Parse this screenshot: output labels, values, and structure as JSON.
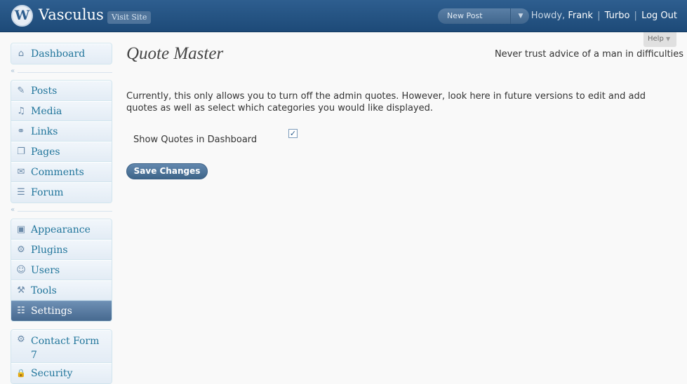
{
  "header": {
    "logo_letter": "W",
    "site_title": "Vasculus",
    "visit_site": "Visit Site",
    "new_post": "New Post",
    "new_post_arrow": "▼",
    "howdy": "Howdy,",
    "user_name": "Frank",
    "sep1": "|",
    "turbo": "Turbo",
    "sep2": "|",
    "log_out": "Log Out"
  },
  "help": {
    "label": "Help",
    "arrow": "▼"
  },
  "sidebar": {
    "group1": [
      {
        "label": "Dashboard",
        "icon": "dashboard-icon",
        "glyph": "⌂"
      }
    ],
    "group2": [
      {
        "label": "Posts",
        "icon": "posts-icon",
        "glyph": "✎"
      },
      {
        "label": "Media",
        "icon": "media-icon",
        "glyph": "♫"
      },
      {
        "label": "Links",
        "icon": "links-icon",
        "glyph": "⚭"
      },
      {
        "label": "Pages",
        "icon": "pages-icon",
        "glyph": "❐"
      },
      {
        "label": "Comments",
        "icon": "comments-icon",
        "glyph": "✉"
      },
      {
        "label": "Forum",
        "icon": "forum-icon",
        "glyph": "☰"
      }
    ],
    "group3": [
      {
        "label": "Appearance",
        "icon": "appearance-icon",
        "glyph": "▣"
      },
      {
        "label": "Plugins",
        "icon": "plugins-icon",
        "glyph": "⚙"
      },
      {
        "label": "Users",
        "icon": "users-icon",
        "glyph": "☺"
      },
      {
        "label": "Tools",
        "icon": "tools-icon",
        "glyph": "⚒"
      },
      {
        "label": "Settings",
        "icon": "settings-icon",
        "glyph": "☷"
      }
    ],
    "group4": [
      {
        "label": "Contact Form 7",
        "icon": "contact-form-icon",
        "glyph": "⚙"
      },
      {
        "label": "Security",
        "icon": "lock-icon",
        "glyph": "🔒"
      }
    ],
    "collapse_arrow": "«",
    "current": "Settings"
  },
  "main": {
    "title": "Quote Master",
    "quote": "Never trust advice of a man in difficulties",
    "description": "Currently, this only allows you to turn off the admin quotes. However, look here in future versions to edit and add quotes as well as select which categories you would like displayed.",
    "option_label": "Show Quotes in Dashboard",
    "option_checked": true,
    "check_glyph": "✓",
    "save_button": "Save Changes"
  },
  "colors": {
    "header_bg": "#2e5e8f",
    "link": "#21759b",
    "current_menu": "#5a7da3"
  }
}
